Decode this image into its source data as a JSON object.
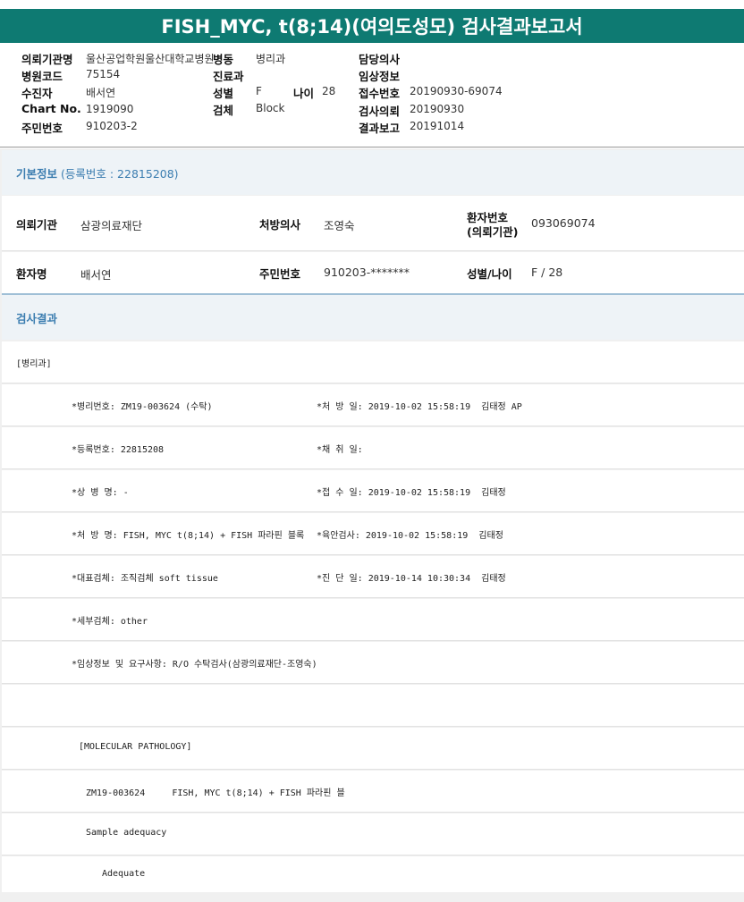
{
  "title": "FISH_MYC, t(8;14)(여의도성모) 검사결과보고서",
  "header": {
    "rows": [
      {
        "l1": "의뢰기관명",
        "v1": "울산공업학원울산대학교병원",
        "l2": "병동",
        "v2": "병리과",
        "l3": "담당의사",
        "v3": ""
      },
      {
        "l1": "병원코드",
        "v1": "75154",
        "l2": "진료과",
        "v2": "",
        "l3": "임상정보",
        "v3": ""
      },
      {
        "l1": "수진자",
        "v1": "배서연",
        "l2": "성별",
        "v2": "F",
        "l2b": "나이",
        "v2b": "28",
        "l3": "접수번호",
        "v3": "20190930-69074"
      },
      {
        "l1": "Chart No.",
        "v1": "1919090",
        "l2": "검체",
        "v2": "Block",
        "l3": "검사의뢰",
        "v3": "20190930"
      },
      {
        "l1": "주민번호",
        "v1": "910203-2",
        "l2": "",
        "v2": "",
        "l3": "결과보고",
        "v3": "20191014"
      }
    ]
  },
  "basic": {
    "heading": "기본정보",
    "reg": "(등록번호 : 22815208)",
    "r1": {
      "l1": "의뢰기관",
      "v1": "삼광의료재단",
      "l2": "처방의사",
      "v2": "조영숙",
      "l3a": "환자번호",
      "l3b": "(의뢰기관)",
      "v3": "093069074"
    },
    "r2": {
      "l1": "환자명",
      "v1": "배서연",
      "l2": "주민번호",
      "v2": "910203-*******",
      "l3": "성별/나이",
      "v3": "F / 28"
    }
  },
  "result": {
    "heading": "검사결과",
    "dept": "[병리과]",
    "lines": [
      {
        "a": "*병리번호: ZM19-003624 (수탁)",
        "b": "*처 방 일: 2019-10-02 15:58:19  김태정 AP"
      },
      {
        "a": "*등록번호: 22815208",
        "b": "*채 취 일:"
      },
      {
        "a": "*상 병 명: -",
        "b": "*접 수 일: 2019-10-02 15:58:19  김태정"
      },
      {
        "a": "*처 방 명: FISH, MYC t(8;14) + FISH 파라핀 블록",
        "b": "*육안검사: 2019-10-02 15:58:19  김태정"
      },
      {
        "a": "*대표검체: 조직검체 soft tissue",
        "b": "*진 단 일: 2019-10-14 10:30:34  김태정"
      },
      {
        "a": "*세부검체: other",
        "b": ""
      },
      {
        "a": "*임상정보 및 요구사항: R/O 수탁검사(삼광의료재단-조영숙)",
        "b": ""
      }
    ],
    "molecular": "[MOLECULAR PATHOLOGY]",
    "mline": "ZM19-003624     FISH, MYC t(8;14) + FISH 파라핀 블",
    "sample_label": "Sample adequacy",
    "sample_value": "Adequate"
  }
}
